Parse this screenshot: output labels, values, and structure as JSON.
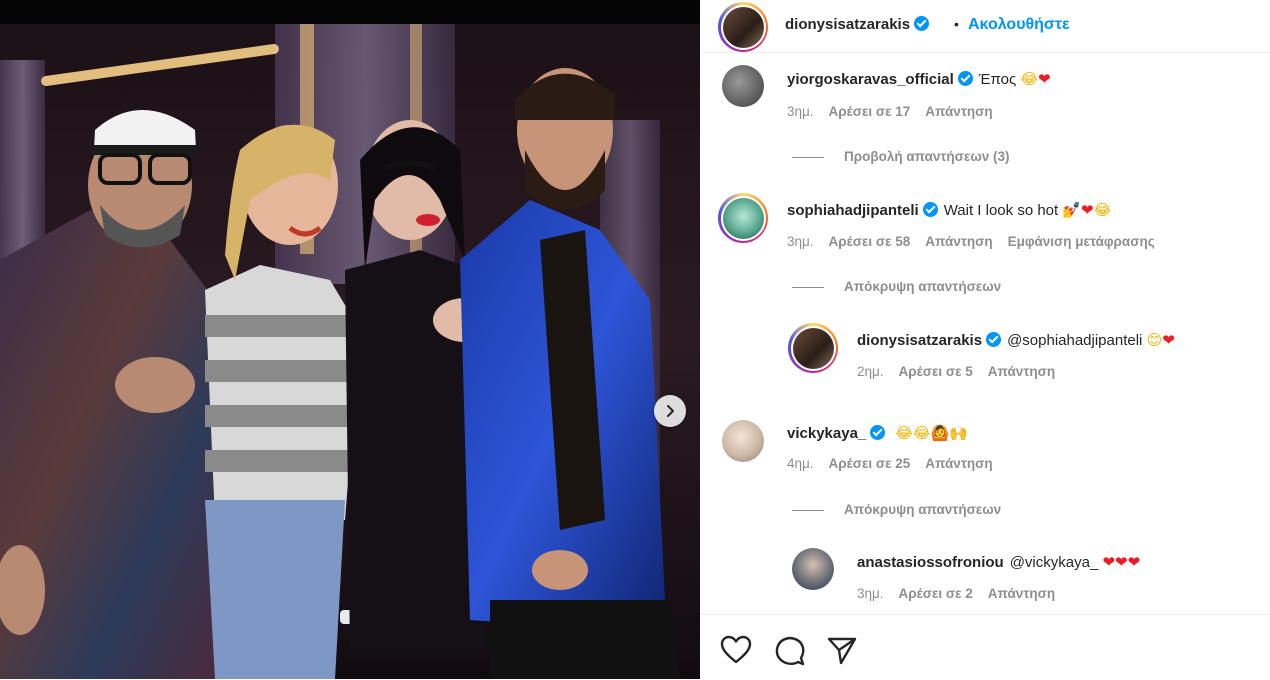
{
  "post_author": {
    "username": "dionysisatzarakis",
    "separator": "•",
    "follow_label": "Ακολουθήστε"
  },
  "comments": [
    {
      "username": "yiorgoskaravas_official",
      "verified": true,
      "text": "Έπος",
      "emojis": [
        "😂",
        "❤"
      ],
      "time": "3ημ.",
      "likes": "Αρέσει σε 17",
      "reply": "Απάντηση",
      "replies_toggle": "Προβολή απαντήσεων (3)"
    },
    {
      "username": "sophiahadjipanteli",
      "verified": true,
      "text": "Wait I look so hot",
      "emojis": [
        "💅",
        "❤",
        "😂"
      ],
      "time": "3ημ.",
      "likes": "Αρέσει σε 58",
      "reply": "Απάντηση",
      "translate": "Εμφάνιση μετάφρασης",
      "replies_toggle": "Απόκρυψη απαντήσεων",
      "reply_item": {
        "username": "dionysisatzarakis",
        "verified": true,
        "text": "@sophiahadjipanteli",
        "emojis": [
          "😊",
          "❤"
        ],
        "time": "2ημ.",
        "likes": "Αρέσει σε 5",
        "reply": "Απάντηση"
      }
    },
    {
      "username": "vickykaya_",
      "verified": true,
      "text": "",
      "emojis": [
        "😂",
        "😂",
        "🙆",
        "🙌"
      ],
      "time": "4ημ.",
      "likes": "Αρέσει σε 25",
      "reply": "Απάντηση",
      "replies_toggle": "Απόκρυψη απαντήσεων",
      "reply_item": {
        "username": "anastasiossofroniou",
        "verified": false,
        "text": "@vickykaya_",
        "emojis": [
          "❤",
          "❤",
          "❤"
        ],
        "time": "3ημ.",
        "likes": "Αρέσει σε 2",
        "reply": "Απάντηση"
      }
    }
  ],
  "icons": {
    "like": "heart-outline-icon",
    "comment": "comment-bubble-icon",
    "share": "paper-plane-icon",
    "next": "chevron-right-icon",
    "verified": "verified-badge-icon"
  },
  "colors": {
    "link_blue": "#0095f6",
    "text": "#262626",
    "secondary": "#8e8e8e",
    "heart": "#ed1c24"
  }
}
